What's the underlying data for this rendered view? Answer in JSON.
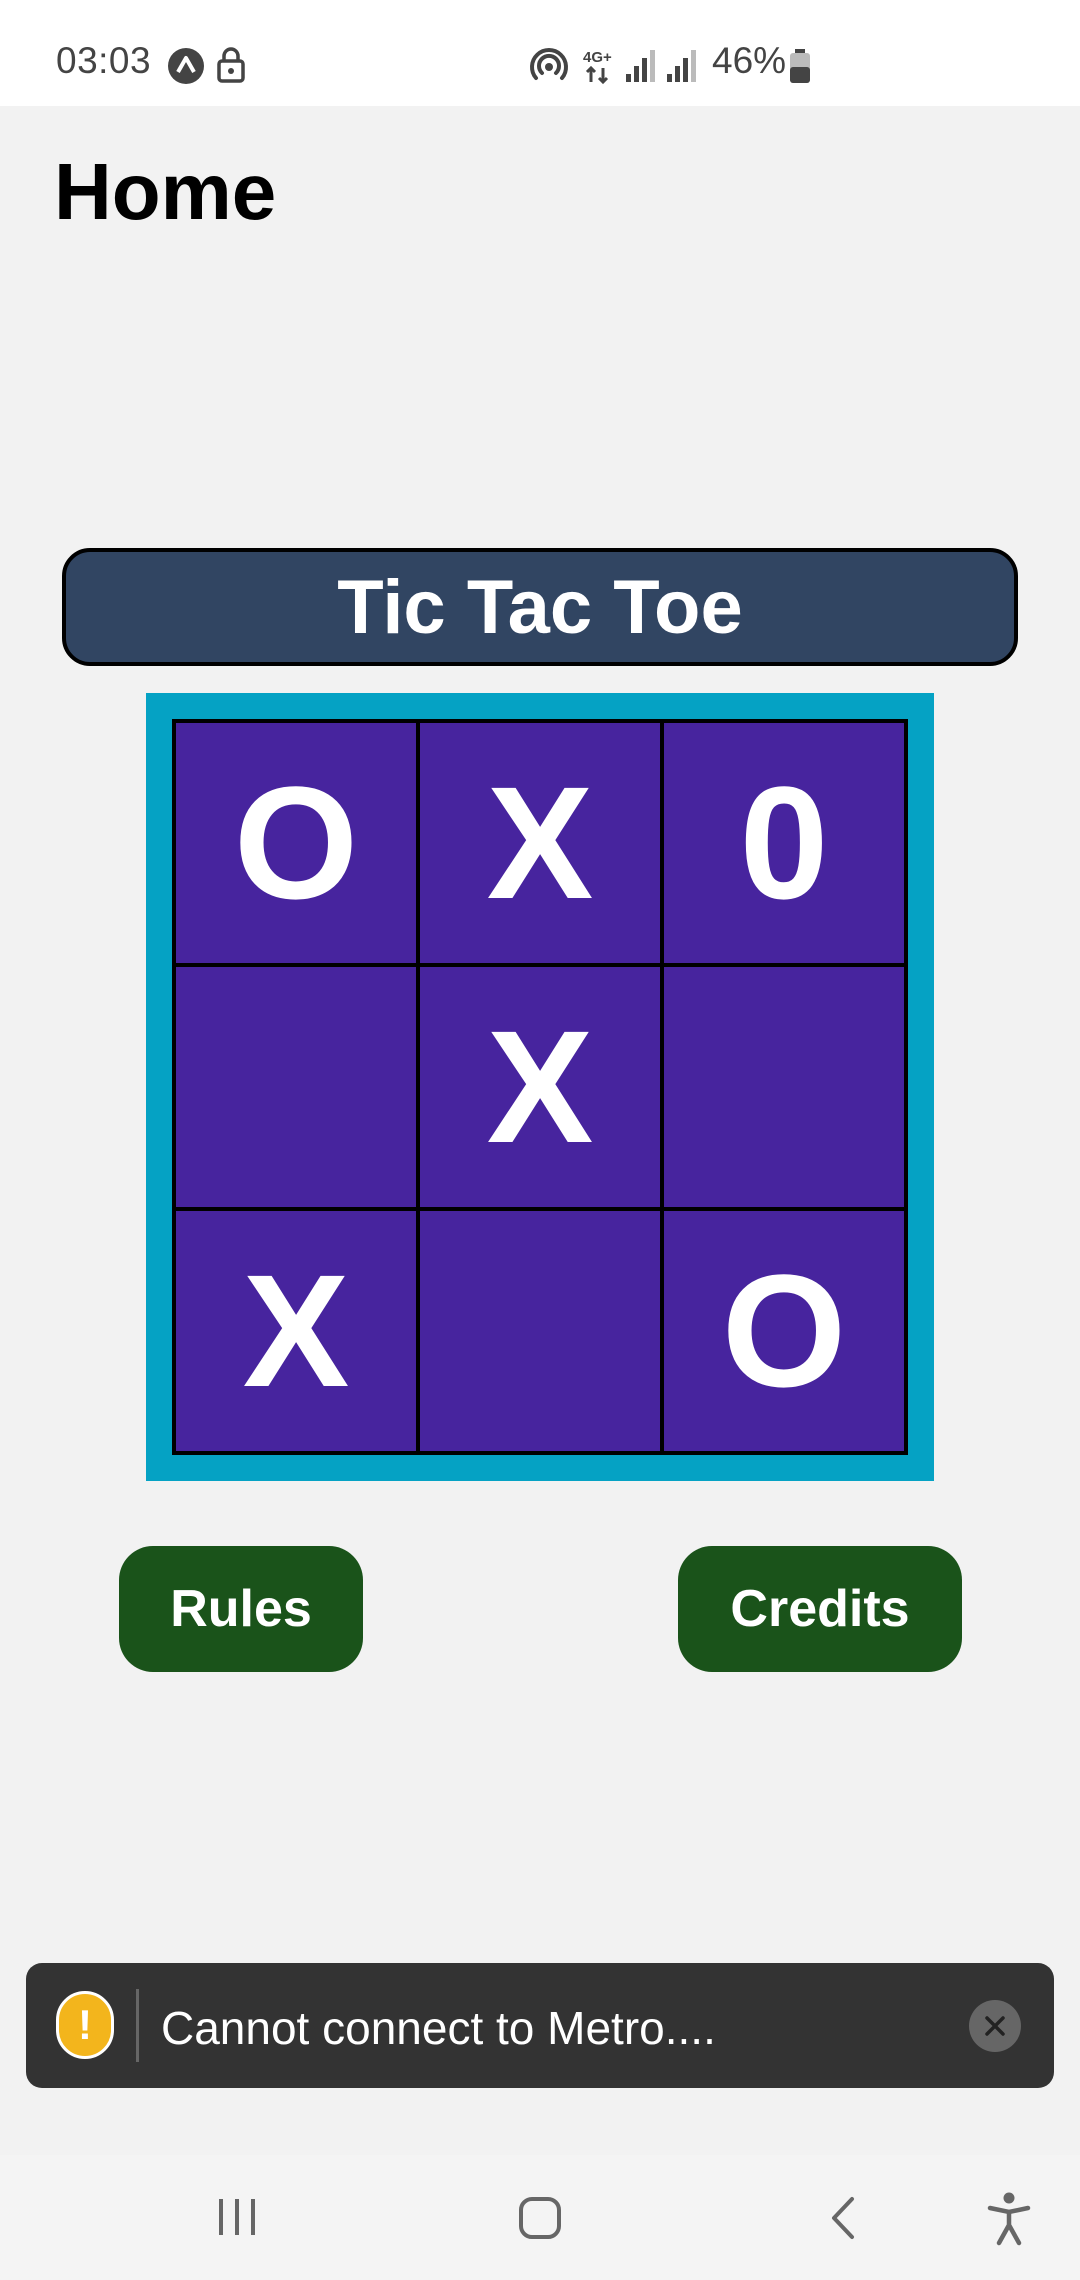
{
  "status_bar": {
    "time": "03:03",
    "battery_percent": "46%",
    "network": "4G+",
    "icons": [
      "app-notification-icon",
      "lock-icon",
      "hotspot-icon",
      "network-4g-icon",
      "signal-icon",
      "signal-icon",
      "battery-icon"
    ]
  },
  "header": {
    "title": "Home"
  },
  "game": {
    "title": "Tic Tac Toe",
    "board": [
      [
        "O",
        "X",
        "0"
      ],
      [
        "",
        "X",
        ""
      ],
      [
        "X",
        "",
        "O"
      ]
    ]
  },
  "buttons": {
    "rules_label": "Rules",
    "credits_label": "Credits"
  },
  "toast": {
    "message": "Cannot connect to Metro....",
    "icon": "warning-icon",
    "close_icon": "close-icon"
  },
  "nav_bar": {
    "icons": [
      "recent-apps-icon",
      "home-icon",
      "back-icon",
      "accessibility-icon"
    ]
  },
  "colors": {
    "banner": "#314562",
    "board_frame": "#05a2c4",
    "cell": "#47249e",
    "button": "#1a531a",
    "toast": "#333333",
    "warning": "#f3b51c"
  }
}
